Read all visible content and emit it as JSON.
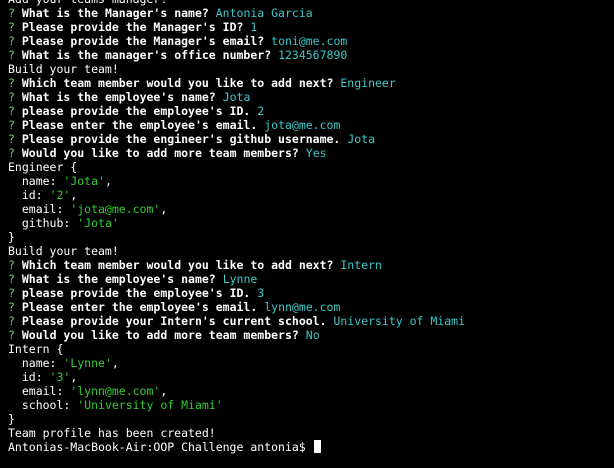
{
  "colors": {
    "background": "#000000",
    "text": "#ffffff",
    "prompt_marker": "#5fd75f",
    "answer": "#3fc7c7",
    "string_value": "#33cc33"
  },
  "lines": [
    {
      "type": "text",
      "text": "Add your teams manager!"
    },
    {
      "type": "qa",
      "mark": "?",
      "q": "What is the Manager's name?",
      "a": "Antonia Garcia"
    },
    {
      "type": "qa",
      "mark": "?",
      "q": "Please provide the Manager's ID?",
      "a": "1"
    },
    {
      "type": "qa",
      "mark": "?",
      "q": "Please provide the Manager's email?",
      "a": "toni@me.com"
    },
    {
      "type": "qa",
      "mark": "?",
      "q": "What is the manager's office number?",
      "a": "1234567890"
    },
    {
      "type": "text",
      "text": "Build your team!"
    },
    {
      "type": "qa",
      "mark": "?",
      "q": "Which team member would you like to add next?",
      "a": "Engineer"
    },
    {
      "type": "qa",
      "mark": "?",
      "q": "What is the employee's name?",
      "a": "Jota"
    },
    {
      "type": "qa",
      "mark": "?",
      "q": "please provide the employee's ID.",
      "a": "2"
    },
    {
      "type": "qa",
      "mark": "?",
      "q": "Please enter the employee's email.",
      "a": "jota@me.com"
    },
    {
      "type": "qa",
      "mark": "?",
      "q": "Please provide the engineer's github username.",
      "a": "Jota"
    },
    {
      "type": "qa",
      "mark": "?",
      "q": "Would you like to add more team members?",
      "a": "Yes"
    },
    {
      "type": "text",
      "text": "Engineer {"
    },
    {
      "type": "prop",
      "key": "  name: ",
      "val": "'Jota'",
      "tail": ","
    },
    {
      "type": "prop",
      "key": "  id: ",
      "val": "'2'",
      "tail": ","
    },
    {
      "type": "prop",
      "key": "  email: ",
      "val": "'jota@me.com'",
      "tail": ","
    },
    {
      "type": "prop",
      "key": "  github: ",
      "val": "'Jota'",
      "tail": ""
    },
    {
      "type": "text",
      "text": "}"
    },
    {
      "type": "text",
      "text": "Build your team!"
    },
    {
      "type": "qa",
      "mark": "?",
      "q": "Which team member would you like to add next?",
      "a": "Intern"
    },
    {
      "type": "qa",
      "mark": "?",
      "q": "What is the employee's name?",
      "a": "Lynne"
    },
    {
      "type": "qa",
      "mark": "?",
      "q": "please provide the employee's ID.",
      "a": "3"
    },
    {
      "type": "qa",
      "mark": "?",
      "q": "Please enter the employee's email.",
      "a": "lynn@me.com"
    },
    {
      "type": "qa",
      "mark": "?",
      "q": "Please provide your Intern's current school.",
      "a": "University of Miami"
    },
    {
      "type": "qa",
      "mark": "?",
      "q": "Would you like to add more team members?",
      "a": "No"
    },
    {
      "type": "text",
      "text": "Intern {"
    },
    {
      "type": "prop",
      "key": "  name: ",
      "val": "'Lynne'",
      "tail": ","
    },
    {
      "type": "prop",
      "key": "  id: ",
      "val": "'3'",
      "tail": ","
    },
    {
      "type": "prop",
      "key": "  email: ",
      "val": "'lynn@me.com'",
      "tail": ","
    },
    {
      "type": "prop",
      "key": "  school: ",
      "val": "'University of Miami'",
      "tail": ""
    },
    {
      "type": "text",
      "text": "}"
    },
    {
      "type": "text",
      "text": "Team profile has been created!"
    },
    {
      "type": "prompt",
      "text": "Antonias-MacBook-Air:OOP Challenge antonia$ "
    }
  ]
}
